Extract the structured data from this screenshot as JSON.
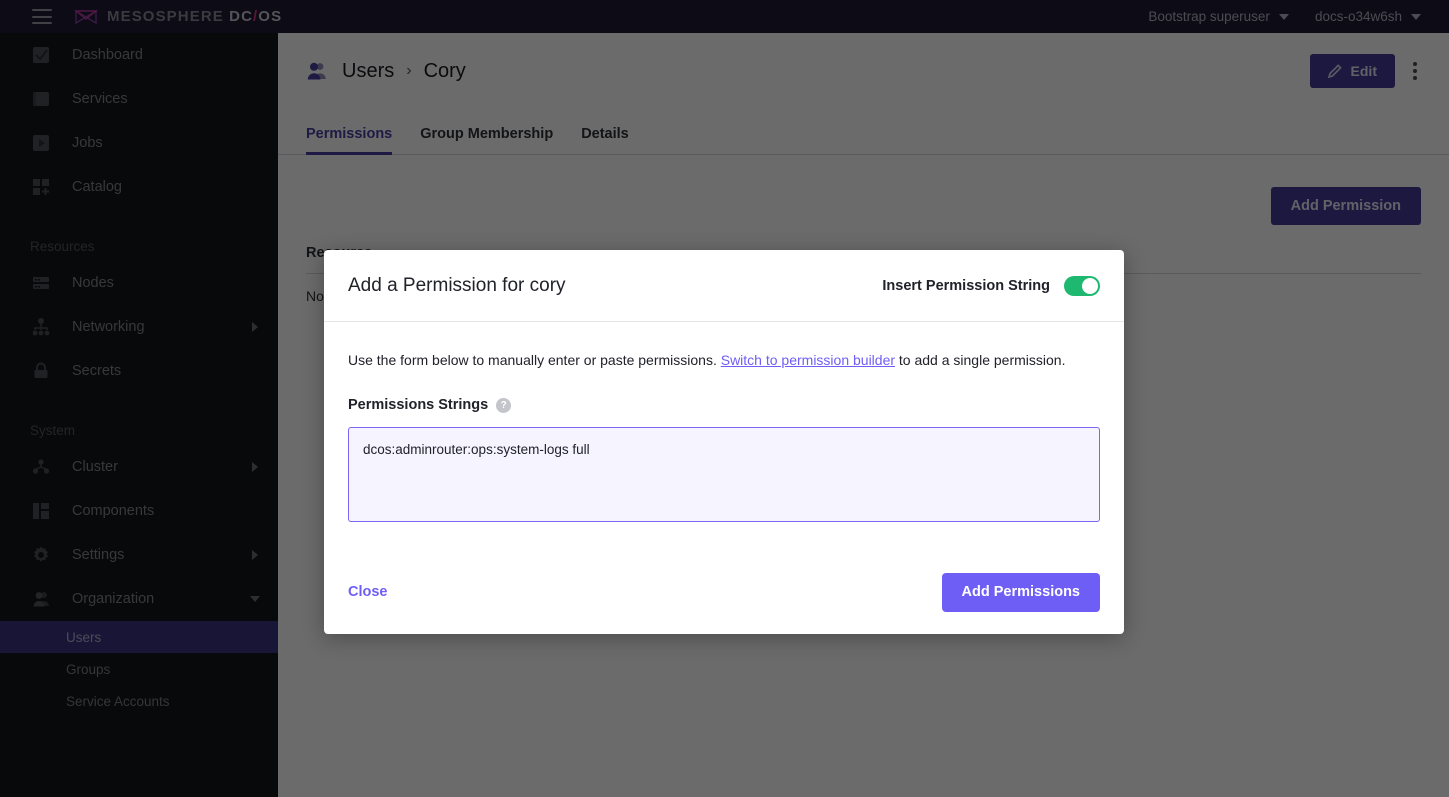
{
  "topbar": {
    "menu_icon": "hamburger-icon",
    "logo_icon": "mesosphere-logo-icon",
    "brand_prefix": "MESOSPHERE",
    "brand_dc": "DC",
    "brand_slash": "/",
    "brand_os": "OS",
    "user_menu": "Bootstrap superuser",
    "cluster_menu": "docs-o34w6sh"
  },
  "sidebar": {
    "primary": [
      {
        "label": "Dashboard",
        "icon": "dashboard-icon"
      },
      {
        "label": "Services",
        "icon": "services-icon"
      },
      {
        "label": "Jobs",
        "icon": "jobs-icon"
      },
      {
        "label": "Catalog",
        "icon": "catalog-icon"
      }
    ],
    "resources_label": "Resources",
    "resources": [
      {
        "label": "Nodes",
        "icon": "nodes-icon",
        "expandable": false
      },
      {
        "label": "Networking",
        "icon": "networking-icon",
        "expandable": true
      },
      {
        "label": "Secrets",
        "icon": "secrets-lock-icon",
        "expandable": false
      }
    ],
    "system_label": "System",
    "system": [
      {
        "label": "Cluster",
        "icon": "cluster-icon",
        "expandable": true
      },
      {
        "label": "Components",
        "icon": "components-icon",
        "expandable": false
      },
      {
        "label": "Settings",
        "icon": "gear-icon",
        "expandable": true
      },
      {
        "label": "Organization",
        "icon": "organization-user-icon",
        "expanded": true
      }
    ],
    "organization_children": [
      {
        "label": "Users",
        "active": true
      },
      {
        "label": "Groups",
        "active": false
      },
      {
        "label": "Service Accounts",
        "active": false
      }
    ]
  },
  "page": {
    "breadcrumb_icon": "user-avatar-icon",
    "breadcrumb_parent": "Users",
    "breadcrumb_separator": "›",
    "breadcrumb_current": "Cory",
    "edit_label": "Edit",
    "edit_icon": "pencil-icon",
    "more_icon": "kebab-menu-icon",
    "tabs": [
      {
        "label": "Permissions",
        "active": true
      },
      {
        "label": "Group Membership",
        "active": false
      },
      {
        "label": "Details",
        "active": false
      }
    ],
    "add_permission_label": "Add Permission",
    "table_header": "Resource",
    "table_empty": "No permissions."
  },
  "modal": {
    "title": "Add a Permission for cory",
    "toggle_label": "Insert Permission String",
    "toggle_on": true,
    "toggle_color": "#1eb871",
    "description_before": "Use the form below to manually enter or paste permissions. ",
    "description_link": "Switch to permission builder",
    "description_after": " to add a single permission.",
    "field_label": "Permissions Strings",
    "help_icon": "question-mark-icon",
    "help_glyph": "?",
    "textarea_value": "dcos:adminrouter:ops:system-logs full",
    "textarea_placeholder": "",
    "close_label": "Close",
    "submit_label": "Add Permissions",
    "accent_color": "#6f5ef5"
  }
}
